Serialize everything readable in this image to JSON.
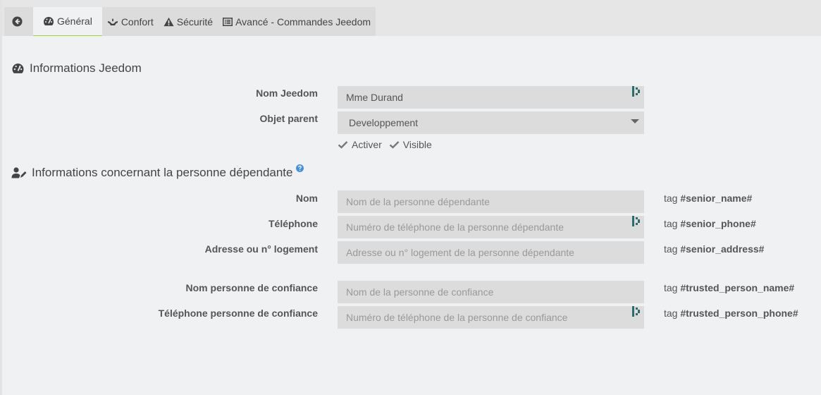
{
  "tabs": [
    {
      "label": "Général",
      "icon": "tachometer-icon",
      "active": true
    },
    {
      "label": "Confort",
      "icon": "hands-icon"
    },
    {
      "label": "Sécurité",
      "icon": "warning-icon"
    },
    {
      "label": "Avancé - Commandes Jeedom",
      "icon": "list-icon"
    }
  ],
  "section_jeedom": {
    "title": "Informations Jeedom",
    "name_label": "Nom Jeedom",
    "name_value": "Mme Durand",
    "parent_label": "Objet parent",
    "parent_value": "Developpement",
    "activate_label": "Activer",
    "visible_label": "Visible"
  },
  "section_person": {
    "title": "Informations concernant la personne dépendante",
    "fields": [
      {
        "label": "Nom",
        "placeholder": "Nom de la personne dépendante",
        "tag_prefix": "tag",
        "tag": "#senior_name#"
      },
      {
        "label": "Téléphone",
        "placeholder": "Numéro de téléphone de la personne dépendante",
        "tag_prefix": "tag",
        "tag": "#senior_phone#"
      },
      {
        "label": "Adresse ou n° logement",
        "placeholder": "Adresse ou n° logement de la personne dépendante",
        "tag_prefix": "tag",
        "tag": "#senior_address#"
      },
      {
        "label": "Nom personne de confiance",
        "placeholder": "Nom de la personne de confiance",
        "tag_prefix": "tag",
        "tag": "#trusted_person_name#"
      },
      {
        "label": "Téléphone personne de confiance",
        "placeholder": "Numéro de téléphone de la personne de confiance",
        "tag_prefix": "tag",
        "tag": "#trusted_person_phone#"
      }
    ]
  },
  "colors": {
    "accent": "#9ccf3b",
    "help": "#4a90d9",
    "field_icon": "#2e6b6b"
  }
}
